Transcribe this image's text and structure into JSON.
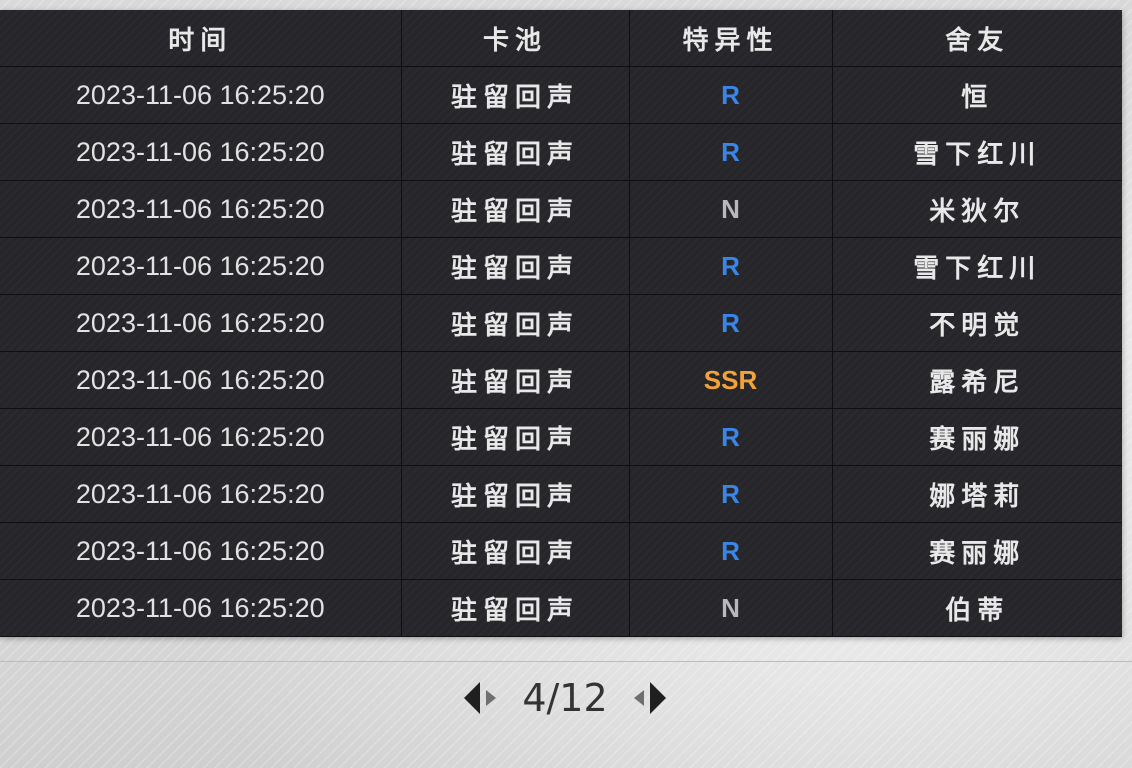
{
  "table": {
    "headers": [
      "时间",
      "卡池",
      "特异性",
      "舍友"
    ],
    "rows": [
      {
        "time": "2023-11-06 16:25:20",
        "pool": "驻留回声",
        "rarity": "R",
        "name": "恒"
      },
      {
        "time": "2023-11-06 16:25:20",
        "pool": "驻留回声",
        "rarity": "R",
        "name": "雪下红川"
      },
      {
        "time": "2023-11-06 16:25:20",
        "pool": "驻留回声",
        "rarity": "N",
        "name": "米狄尔"
      },
      {
        "time": "2023-11-06 16:25:20",
        "pool": "驻留回声",
        "rarity": "R",
        "name": "雪下红川"
      },
      {
        "time": "2023-11-06 16:25:20",
        "pool": "驻留回声",
        "rarity": "R",
        "name": "不明觉"
      },
      {
        "time": "2023-11-06 16:25:20",
        "pool": "驻留回声",
        "rarity": "SSR",
        "name": "露希尼"
      },
      {
        "time": "2023-11-06 16:25:20",
        "pool": "驻留回声",
        "rarity": "R",
        "name": "赛丽娜"
      },
      {
        "time": "2023-11-06 16:25:20",
        "pool": "驻留回声",
        "rarity": "R",
        "name": "娜塔莉"
      },
      {
        "time": "2023-11-06 16:25:20",
        "pool": "驻留回声",
        "rarity": "R",
        "name": "赛丽娜"
      },
      {
        "time": "2023-11-06 16:25:20",
        "pool": "驻留回声",
        "rarity": "N",
        "name": "伯蒂"
      }
    ]
  },
  "rarity_colors": {
    "R": "#3a86e8",
    "N": "#b9b9b9",
    "SSR": "#f2a23a"
  },
  "pager": {
    "label": "4/12",
    "prev_icon": "prev-page-arrow-icon",
    "next_icon": "next-page-arrow-icon"
  }
}
